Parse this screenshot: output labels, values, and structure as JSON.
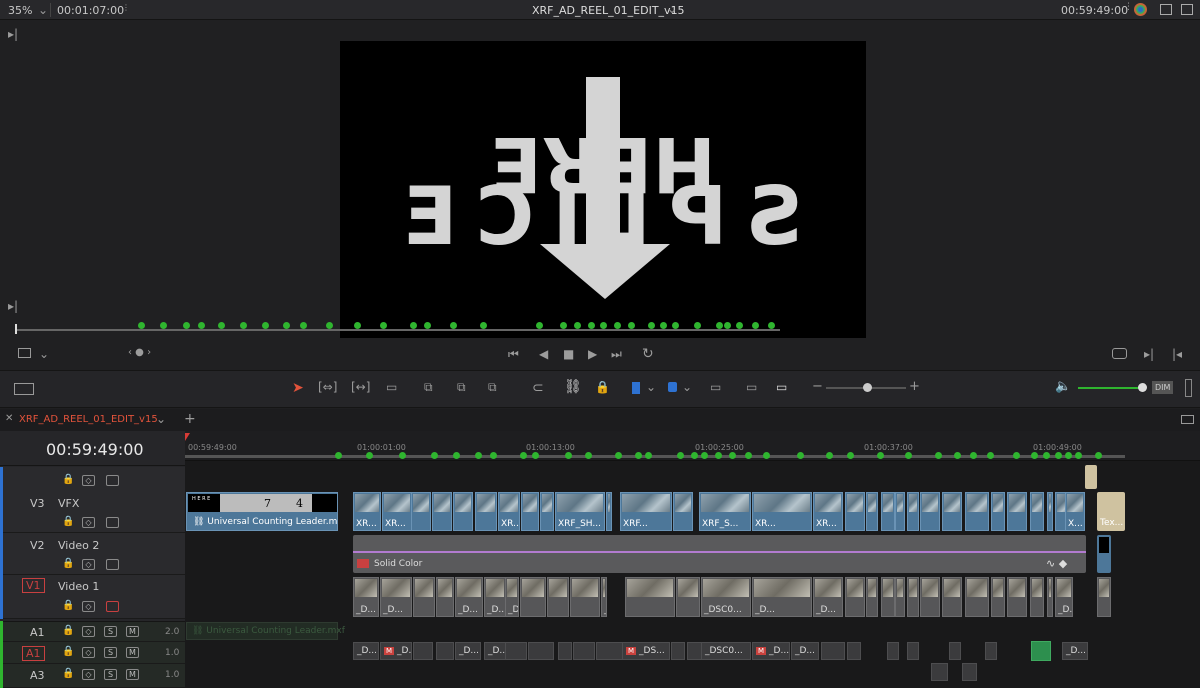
{
  "topbar": {
    "zoom": "35%",
    "source_timecode": "00:01:07:00",
    "title": "XRF_AD_REEL_01_EDIT_v15",
    "record_timecode": "00:59:49:00"
  },
  "viewer_frame": {
    "line1": "HERE",
    "line2": "SPLICE"
  },
  "timeline": {
    "tab": "XRF_AD_REEL_01_EDIT_v15",
    "timecode": "00:59:49:00",
    "ruler": [
      "00:59:49:00",
      "01:00:01:00",
      "01:00:13:00",
      "01:00:25:00",
      "01:00:37:00",
      "01:00:49:00"
    ],
    "tracks": {
      "v3": {
        "id": "V3",
        "name": "VFX"
      },
      "v2": {
        "id": "V2",
        "name": "Video 2"
      },
      "v1": {
        "id": "V1",
        "name": "Video 1"
      },
      "a1": {
        "id": "A1",
        "level": "2.0"
      },
      "a1b": {
        "id": "A1",
        "level": "1.0"
      },
      "a3": {
        "id": "A3",
        "level": "1.0"
      }
    },
    "leader_clip": "Universal Counting Leader.mxf",
    "leader_digits": [
      "7",
      "4"
    ],
    "solid_clip": "Solid Color",
    "audio_leader": "Universal Counting Leader.mxf",
    "v3_labels": [
      "XR...",
      "XR...",
      "XR...",
      "XR...",
      "XRF_SH...",
      "XRF...",
      "XRF_S...",
      "XR...",
      "XR...",
      "X...",
      "Tex..."
    ],
    "v1_labels": [
      "_D...",
      "_D...",
      "_D...",
      "_D...",
      "_D...",
      "_DS...",
      "_DSC0...",
      "_D...",
      "_D...",
      "_D..."
    ],
    "a_labels": [
      "_D...",
      "_D...",
      "_D...",
      "_D...",
      "_DS...",
      "_DSC0...",
      "_D...",
      "_D...",
      "_D...",
      "_D..."
    ],
    "dim_label": "DIM"
  }
}
